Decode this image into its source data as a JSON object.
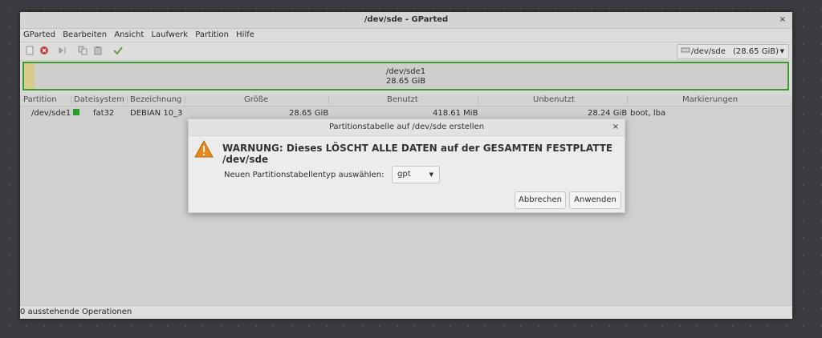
{
  "window": {
    "title": "/dev/sde - GParted",
    "close": "×"
  },
  "menu": [
    "GParted",
    "Bearbeiten",
    "Ansicht",
    "Laufwerk",
    "Partition",
    "Hilfe"
  ],
  "toolbar": {
    "icons": [
      "new-icon",
      "delete-icon",
      "resize-icon",
      "copy-icon",
      "paste-icon",
      "apply-icon"
    ],
    "device": {
      "label": "/dev/sde",
      "size": "(28.65 GiB)"
    }
  },
  "graph": {
    "name": "/dev/sde1",
    "size": "28.65 GiB"
  },
  "table": {
    "headers": [
      "Partition",
      "Dateisystem",
      "Bezeichnung",
      "Größe",
      "Benutzt",
      "Unbenutzt",
      "Markierungen"
    ],
    "rows": [
      {
        "partition": "/dev/sde1",
        "filesystem": "fat32",
        "label": "DEBIAN 10_3",
        "size": "28.65 GiB",
        "used": "418.61 MiB",
        "unused": "28.24 GiB",
        "flags": "boot, lba"
      }
    ]
  },
  "status": "0 ausstehende Operationen",
  "dialog": {
    "title": "Partitionstabelle auf /dev/sde erstellen",
    "close": "×",
    "warning": "WARNUNG:  Dieses LÖSCHT ALLE DATEN auf der GESAMTEN FESTPLATTE /dev/sde",
    "prompt": "Neuen Partitionstabellentyp auswählen:",
    "selected_type": "gpt",
    "cancel": "Abbrechen",
    "apply": "Anwenden"
  },
  "colors": {
    "fat32": "#2aa82a",
    "partition_border": "#3da533",
    "warning": "#e8891c"
  }
}
